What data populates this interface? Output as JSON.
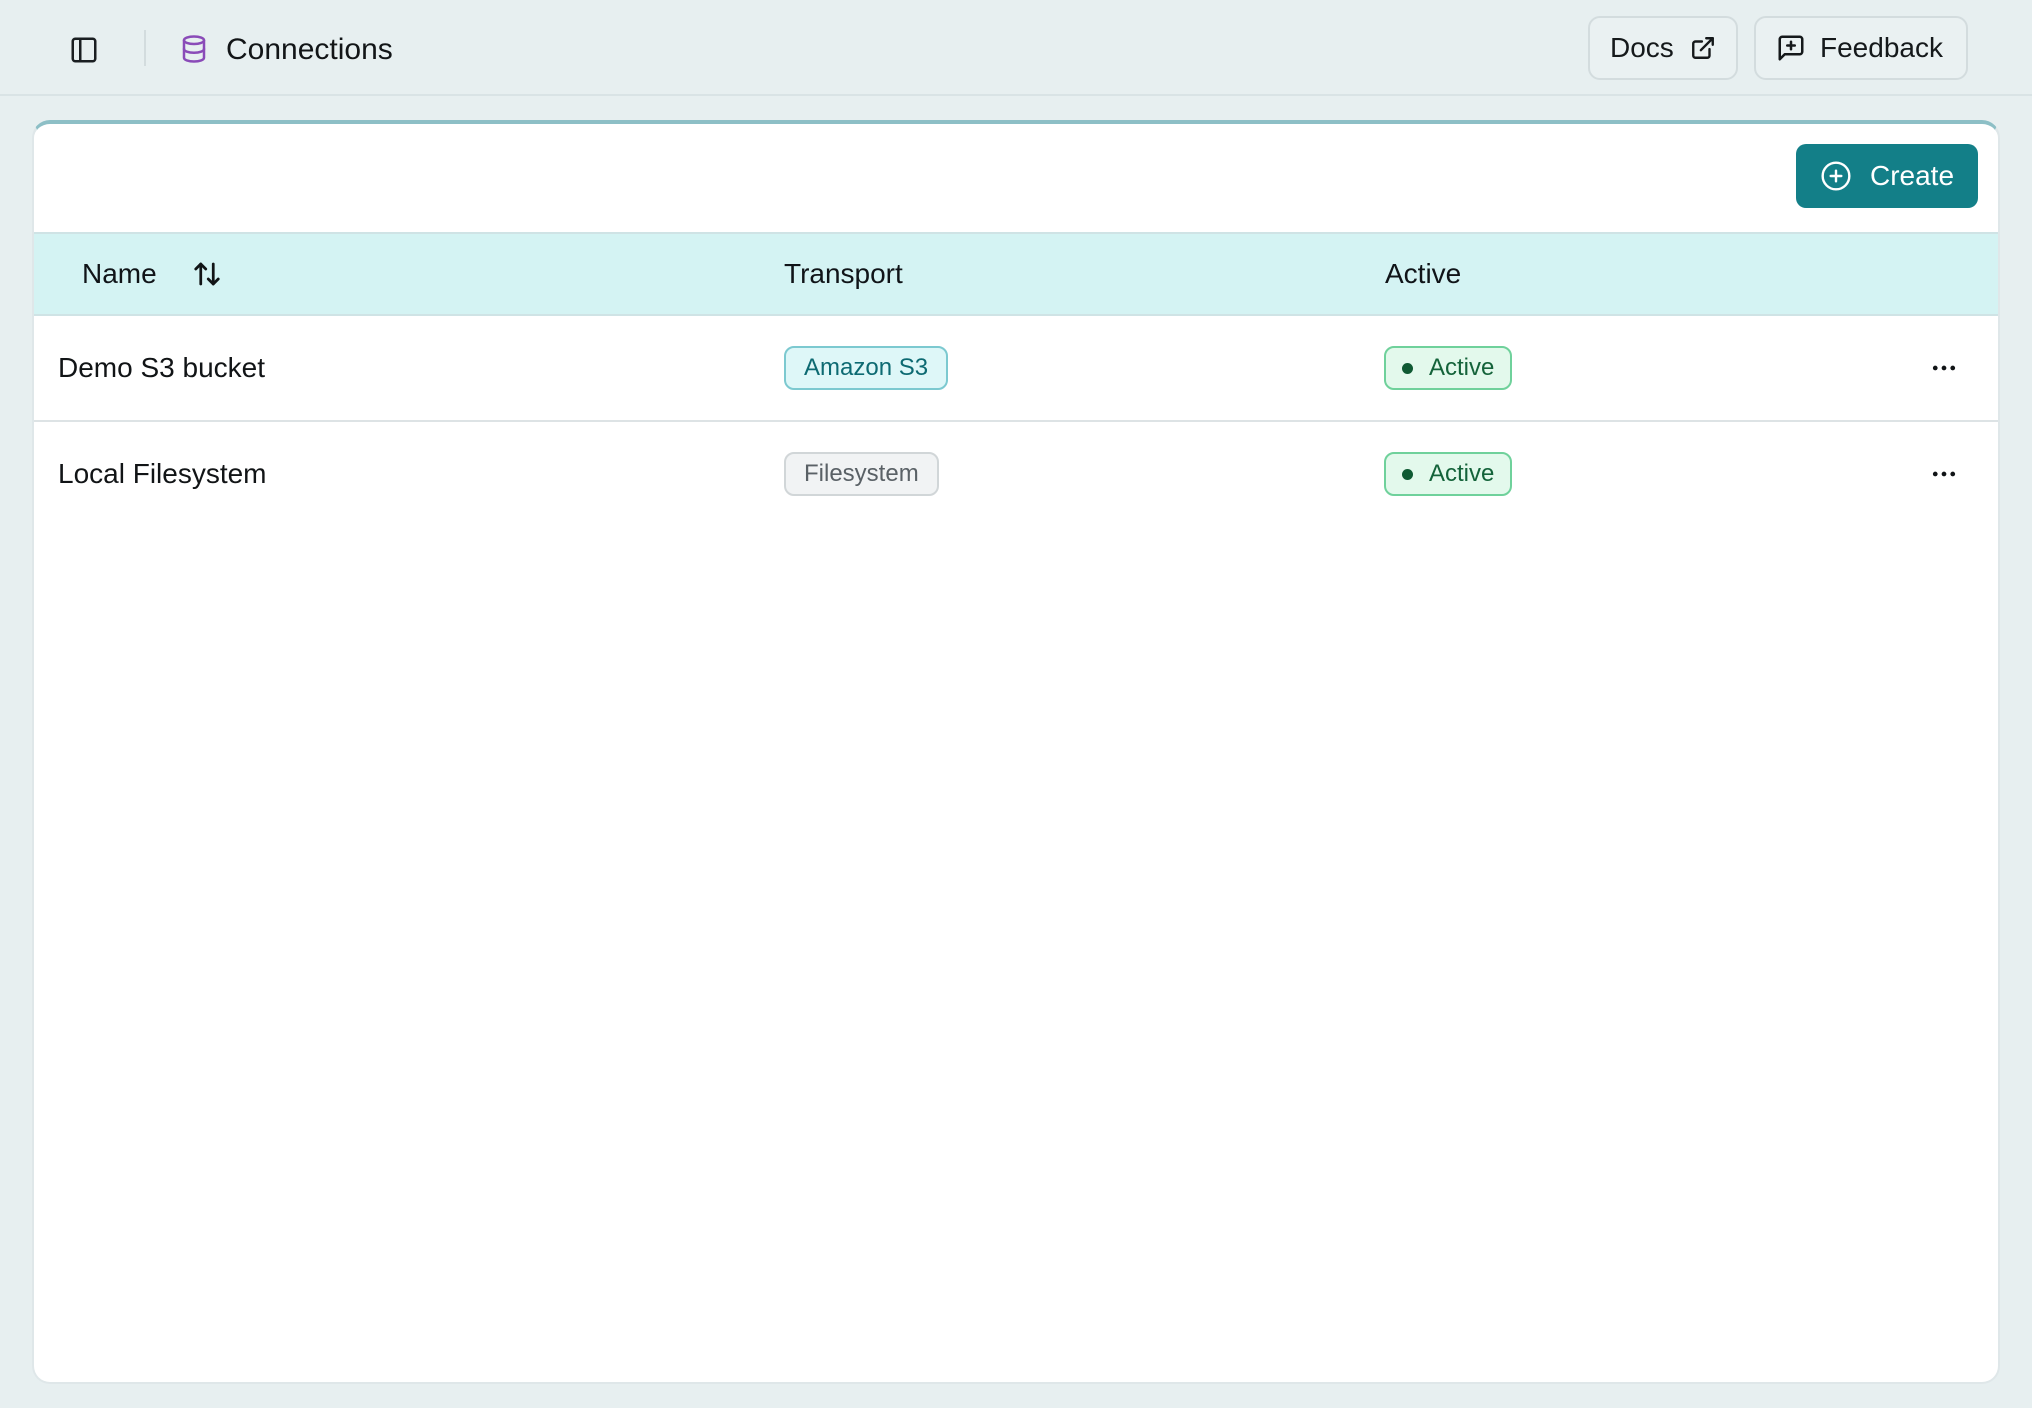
{
  "header": {
    "title": "Connections",
    "docs_label": "Docs",
    "feedback_label": "Feedback"
  },
  "toolbar": {
    "create_label": "Create"
  },
  "table": {
    "columns": {
      "name": "Name",
      "transport": "Transport",
      "active": "Active"
    },
    "rows": [
      {
        "name": "Demo S3 bucket",
        "transport": "Amazon S3",
        "status": "Active"
      },
      {
        "name": "Local Filesystem",
        "transport": "Filesystem",
        "status": "Active"
      }
    ]
  },
  "icons": {
    "sidebar_toggle": "sidebar-toggle-icon",
    "connections": "database-icon",
    "docs": "external-link-icon",
    "feedback": "message-square-plus-icon",
    "create": "plus-circle-icon",
    "sort": "arrow-up-down-icon",
    "row_menu": "more-horizontal-icon"
  },
  "colors": {
    "accent": "#137f88",
    "header_bg": "#d4f3f3",
    "database_icon": "#8a4bb8",
    "active_badge": "#e3f9ec"
  }
}
